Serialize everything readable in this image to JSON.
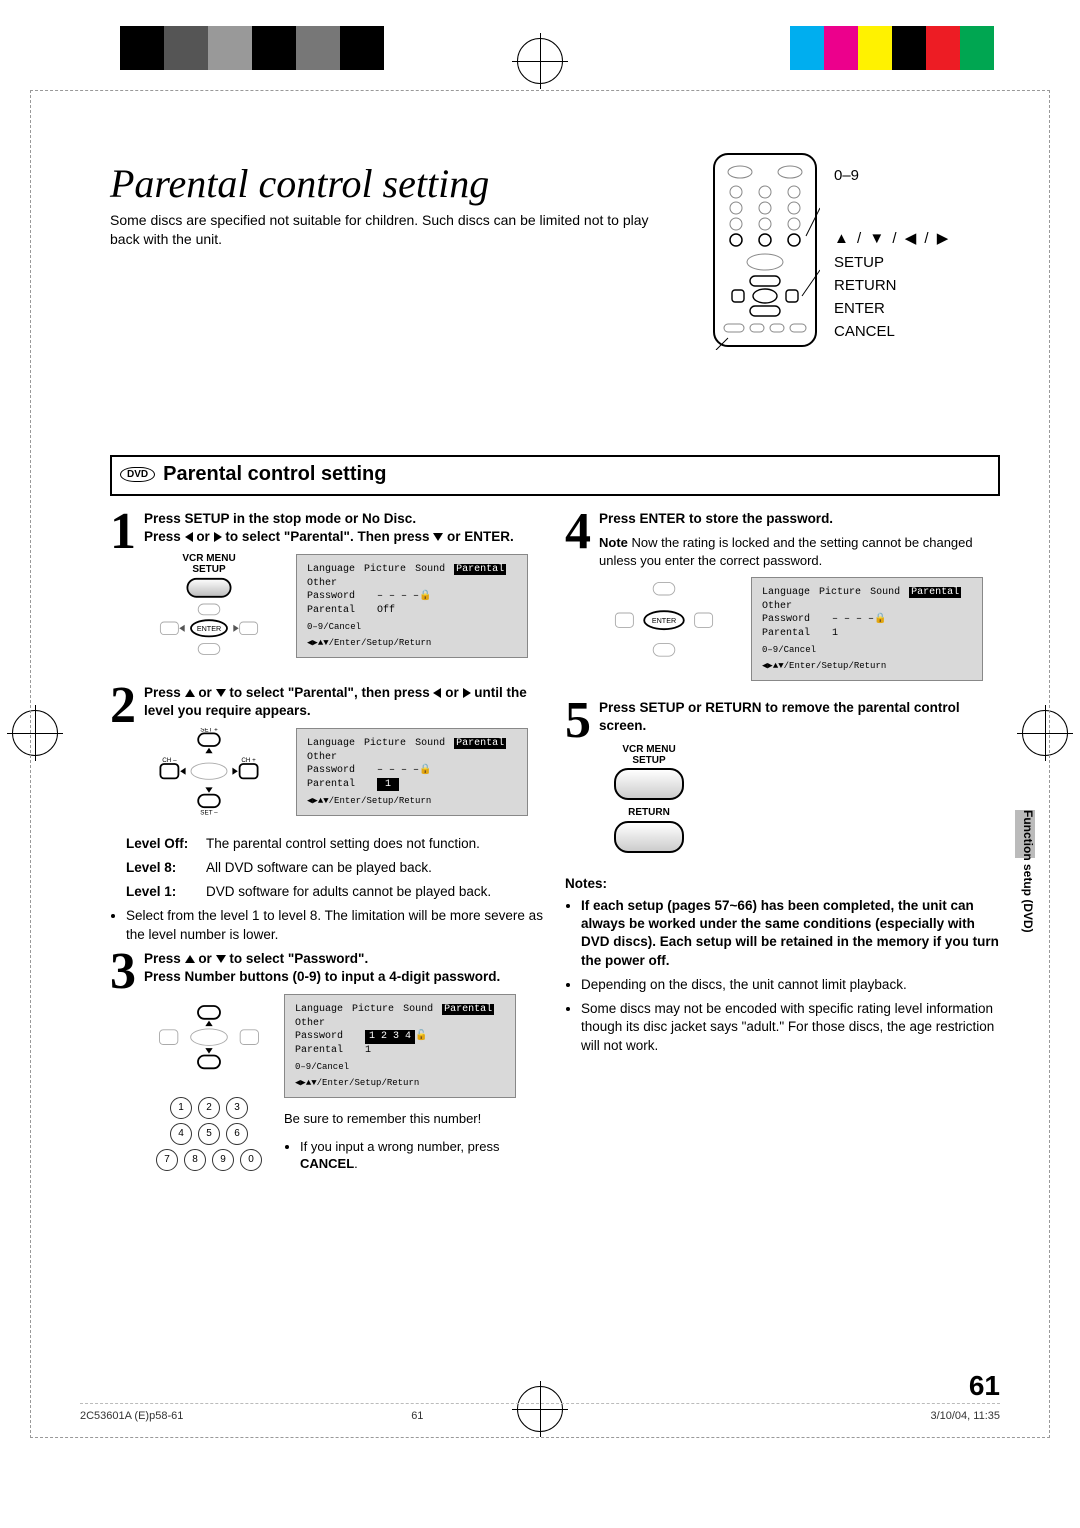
{
  "title_italic": "Parental control setting",
  "intro": "Some discs are specified not suitable for children. Such discs can be limited not to play back with the unit.",
  "remote_labels": {
    "digits": "0–9",
    "arrows": "▲ / ▼ / ◀ / ▶",
    "setup": "SETUP",
    "return": "RETURN",
    "enter": "ENTER",
    "cancel": "CANCEL"
  },
  "section_title": "Parental control setting",
  "dvd_badge": "DVD",
  "steps": {
    "s1": {
      "num": "1",
      "line1": "Press SETUP in the stop mode or No Disc.",
      "line2a": "Press ",
      "line2b": " or ",
      "line2c": " to select \"Parental\". Then press ",
      "line2d": " or ENTER.",
      "nav_top": "VCR MENU\nSETUP",
      "enter": "ENTER",
      "osd": {
        "tabs": [
          "Language",
          "Picture",
          "Sound",
          "Parental",
          "Other"
        ],
        "password": "Password",
        "password_val": "– – – –",
        "parental": "Parental",
        "parental_val": "Off",
        "hint1": "0–9/Cancel",
        "hint2": "◀▶▲▼/Enter/Setup/Return"
      }
    },
    "s2": {
      "num": "2",
      "line1a": "Press ",
      "line1b": " or ",
      "line1c": " to select \"Parental\", then press ",
      "line1d": " or ",
      "line1e": " until the level you require appears.",
      "osd": {
        "tabs": [
          "Language",
          "Picture",
          "Sound",
          "Parental",
          "Other"
        ],
        "password": "Password",
        "password_val": "– – – –",
        "parental": "Parental",
        "parental_val": "1",
        "hint2": "◀▶▲▼/Enter/Setup/Return"
      }
    },
    "s3": {
      "num": "3",
      "line1a": "Press ",
      "line1b": " or ",
      "line1c": " to select \"Password\".",
      "line2": "Press Number buttons (0-9) to input a 4-digit password.",
      "osd": {
        "tabs": [
          "Language",
          "Picture",
          "Sound",
          "Parental",
          "Other"
        ],
        "password": "Password",
        "password_val": "1 2 3 4",
        "parental": "Parental",
        "parental_val": "1",
        "hint1": "0–9/Cancel",
        "hint2": "◀▶▲▼/Enter/Setup/Return"
      },
      "remember": "Be sure to remember this number!",
      "wrong1": "If you input a wrong number, press ",
      "wrong2": "CANCEL",
      "wrong3": "."
    },
    "s4": {
      "num": "4",
      "line1": "Press ENTER to store the password.",
      "note_lead": "Note",
      "note_body": " Now the rating is locked and the setting cannot be changed unless you enter the correct password.",
      "osd": {
        "tabs": [
          "Language",
          "Picture",
          "Sound",
          "Parental",
          "Other"
        ],
        "password": "Password",
        "password_val": "– – – –",
        "parental": "Parental",
        "parental_val": "1",
        "hint1": "0–9/Cancel",
        "hint2": "◀▶▲▼/Enter/Setup/Return"
      }
    },
    "s5": {
      "num": "5",
      "line1": "Press SETUP or RETURN to remove the parental control screen.",
      "vcr_menu": "VCR MENU\nSETUP",
      "return_lbl": "RETURN"
    }
  },
  "levels": {
    "off_label": "Level Off:",
    "off_text": "The parental control setting does not function.",
    "l8_label": "Level 8:",
    "l8_text": "All DVD software can be played back.",
    "l1_label": "Level 1:",
    "l1_text": "DVD software for adults cannot be played back.",
    "range_note": "Select from the level 1 to level 8. The limitation will be more severe as the level number is lower."
  },
  "notes": {
    "heading": "Notes:",
    "n1": "If each setup (pages 57~66) has been completed, the unit can always be worked under the same conditions (especially with DVD discs). Each setup will be retained in the memory if you turn the power off.",
    "n2": "Depending on the discs, the unit cannot limit playback.",
    "n3": "Some discs may not be encoded with specific rating level information though its disc jacket says \"adult.\" For those discs, the age restriction will not work."
  },
  "side_tab": "Function setup (DVD)",
  "page_number": "61",
  "footer": {
    "left": "2C53601A (E)p58-61",
    "mid": "61",
    "right": "3/10/04, 11:35"
  },
  "keypad": [
    "1",
    "2",
    "3",
    "4",
    "5",
    "6",
    "7",
    "8",
    "9",
    "0"
  ],
  "color_bar": [
    "#00aeef",
    "#ec008c",
    "#fff200",
    "#000000",
    "#ed1c24",
    "#00a651",
    "#ffffff"
  ]
}
